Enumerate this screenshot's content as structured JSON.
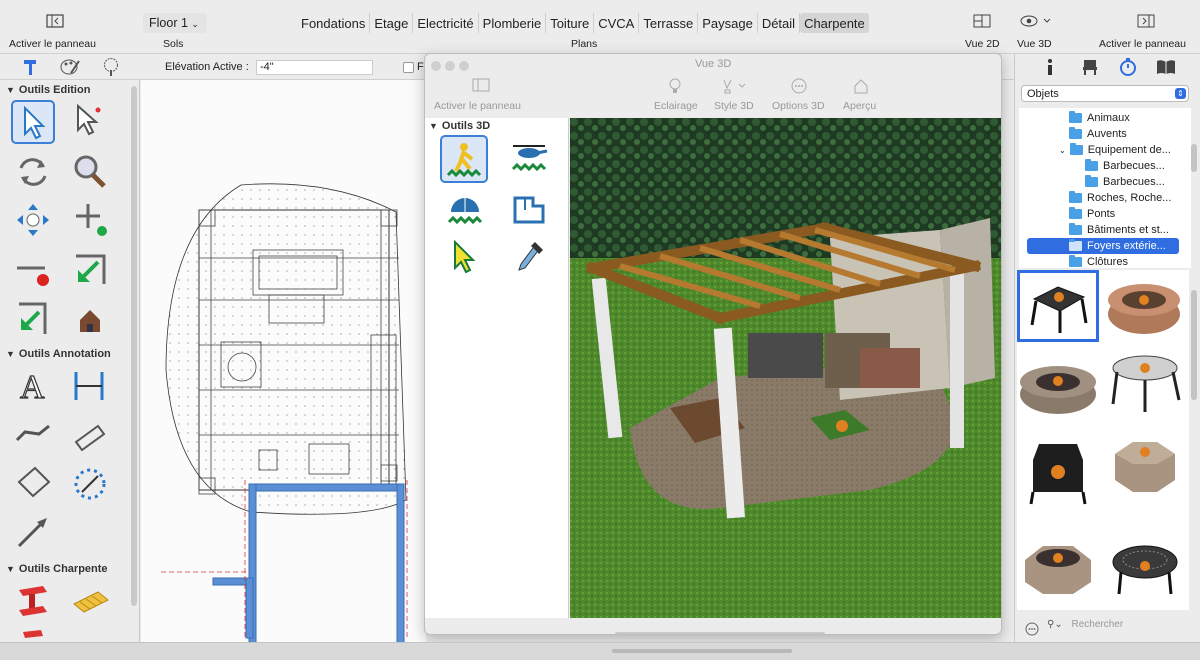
{
  "toolbar": {
    "left_panel_label": "Activer le panneau",
    "floor": "Floor 1",
    "sols_label": "Sols",
    "plans_label": "Plans",
    "tabs": [
      "Fondations",
      "Etage",
      "Electricité",
      "Plomberie",
      "Toiture",
      "CVCA",
      "Terrasse",
      "Paysage",
      "Détail",
      "Charpente"
    ],
    "active_tab": "Charpente",
    "view2d_label": "Vue 2D",
    "view3d_label": "Vue 3D",
    "right_panel_label": "Activer le panneau"
  },
  "subbar": {
    "elevation_label": "Elévation Active :",
    "elevation_value": "-4\"",
    "checkbox_label": "Fl"
  },
  "left_panel": {
    "sections": [
      "Outils Edition",
      "Outils Annotation",
      "Outils Charpente"
    ]
  },
  "window3d": {
    "title": "Vue 3D",
    "panel_label": "Activer le panneau",
    "buttons": [
      "Eclairage",
      "Style 3D",
      "Options 3D",
      "Aperçu"
    ],
    "section": "Outils 3D"
  },
  "right_panel": {
    "select_value": "Objets",
    "tree": [
      {
        "label": "Animaux",
        "level": 1
      },
      {
        "label": "Auvents",
        "level": 1
      },
      {
        "label": "Equipement de...",
        "level": 1,
        "expanded": true
      },
      {
        "label": "Barbecues...",
        "level": 2
      },
      {
        "label": "Barbecues...",
        "level": 2
      },
      {
        "label": "Roches, Roche...",
        "level": 1
      },
      {
        "label": "Ponts",
        "level": 1
      },
      {
        "label": "Bâtiments et st...",
        "level": 1
      },
      {
        "label": "Foyers extérie...",
        "level": 1,
        "selected": true
      },
      {
        "label": "Clôtures",
        "level": 1
      }
    ],
    "search_placeholder": "Rechercher"
  },
  "colors": {
    "accent": "#2f6de1",
    "selection_border": "#3b7fd6"
  }
}
